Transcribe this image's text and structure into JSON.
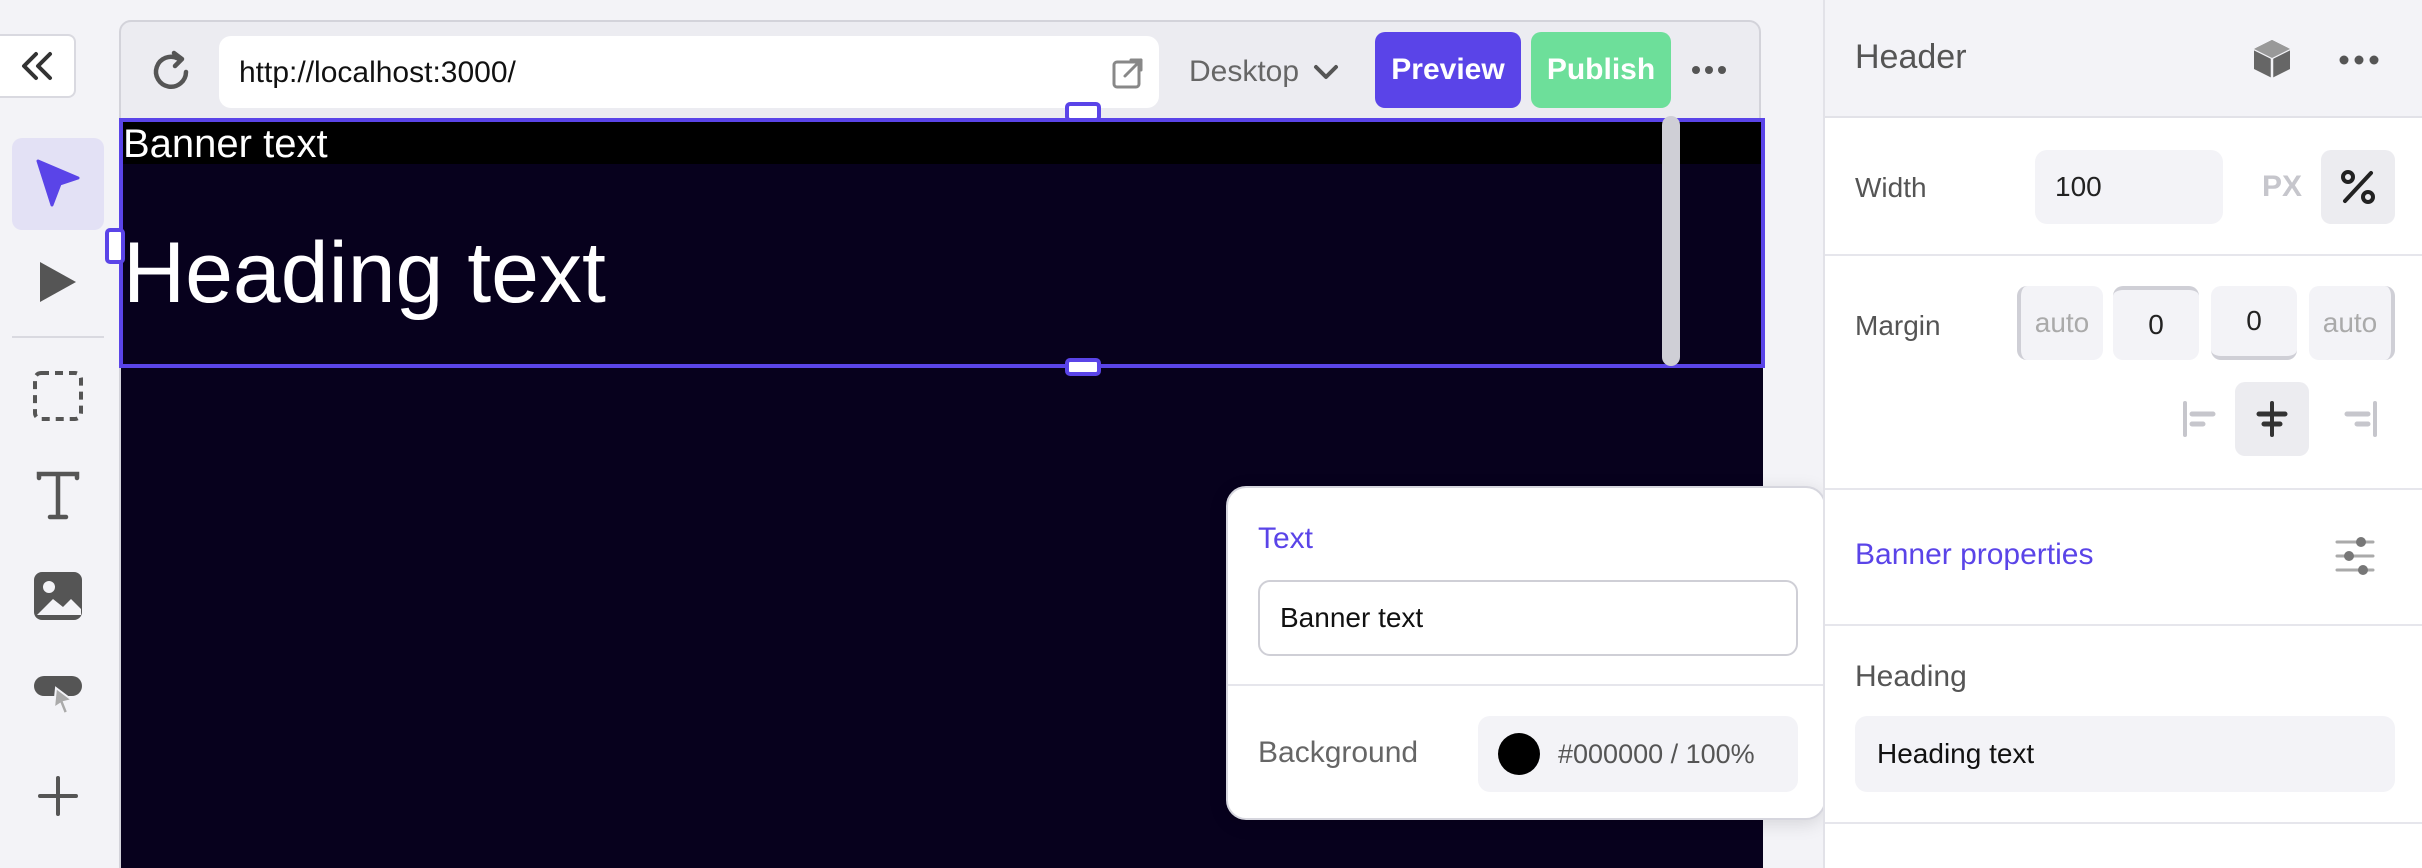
{
  "toolbar": {
    "tools": [
      {
        "name": "select-tool",
        "icon": "pointer-icon",
        "active": true
      },
      {
        "name": "play-tool",
        "icon": "play-icon"
      },
      {
        "name": "container-tool",
        "icon": "dashed-box-icon"
      },
      {
        "name": "text-tool",
        "icon": "text-icon"
      },
      {
        "name": "image-tool",
        "icon": "image-icon"
      },
      {
        "name": "button-tool",
        "icon": "button-click-icon"
      },
      {
        "name": "add-tool",
        "icon": "plus-icon"
      }
    ]
  },
  "browser": {
    "url": "http://localhost:3000/",
    "device": "Desktop",
    "preview_label": "Preview",
    "publish_label": "Publish"
  },
  "canvas": {
    "banner_text": "Banner text",
    "heading_text": "Heading text"
  },
  "popup": {
    "title": "Text",
    "text_value": "Banner text",
    "background_label": "Background",
    "background_value": "#000000 / 100%"
  },
  "panel": {
    "title": "Header",
    "width_label": "Width",
    "width_value": "100",
    "unit_px": "PX",
    "margin_label": "Margin",
    "margin_values": [
      "auto",
      "0",
      "0",
      "auto"
    ],
    "banner_properties_label": "Banner properties",
    "heading_label": "Heading",
    "heading_value": "Heading text"
  },
  "colors": {
    "accent": "#5a44e8",
    "publish": "#6ddf9a",
    "canvas_bg": "#07011d",
    "banner_bg": "#000000"
  }
}
